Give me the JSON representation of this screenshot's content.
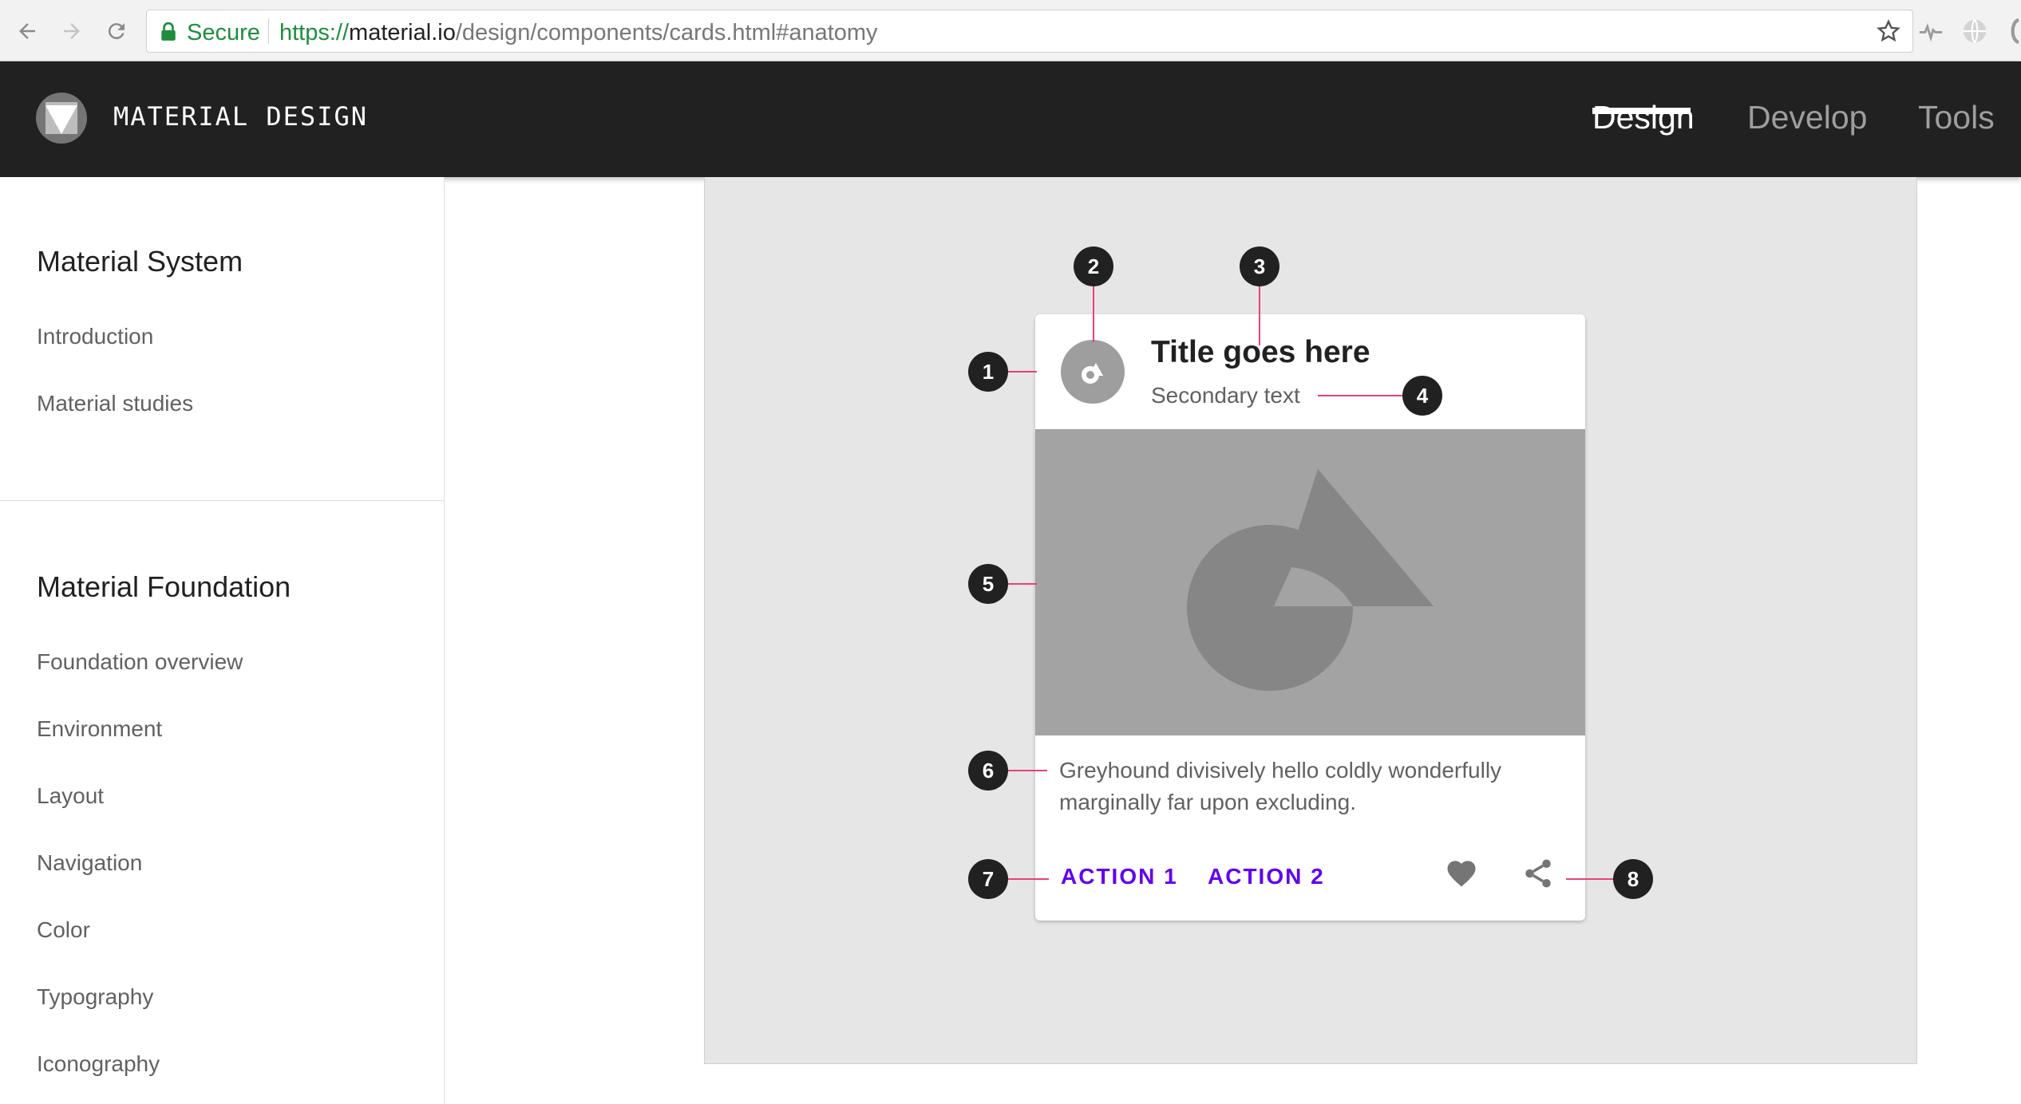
{
  "browser": {
    "secure_label": "Secure",
    "url_scheme": "https://",
    "url_host": "material.io",
    "url_path": "/design/components/cards.html#anatomy"
  },
  "app_bar": {
    "brand": "MATERIAL DESIGN",
    "tabs": [
      {
        "label": "Design",
        "active": true
      },
      {
        "label": "Develop",
        "active": false
      },
      {
        "label": "Tools",
        "active": false
      }
    ]
  },
  "sidebar": {
    "sections": [
      {
        "heading": "Material System",
        "items": [
          "Introduction",
          "Material studies"
        ]
      },
      {
        "heading": "Material Foundation",
        "items": [
          "Foundation overview",
          "Environment",
          "Layout",
          "Navigation",
          "Color",
          "Typography",
          "Iconography"
        ]
      }
    ]
  },
  "card": {
    "title": "Title goes here",
    "subtitle": "Secondary text",
    "supporting_text": "Greyhound divisively hello coldly wonderfully marginally far upon excluding.",
    "actions": [
      "ACTION 1",
      "ACTION 2"
    ],
    "icons": [
      "heart-icon",
      "share-icon"
    ]
  },
  "callouts": [
    "1",
    "2",
    "3",
    "4",
    "5",
    "6",
    "7",
    "8"
  ],
  "colors": {
    "app_bar": "#212121",
    "action": "#6200ee",
    "leader": "#e8417a",
    "secure": "#1e8e3e"
  }
}
